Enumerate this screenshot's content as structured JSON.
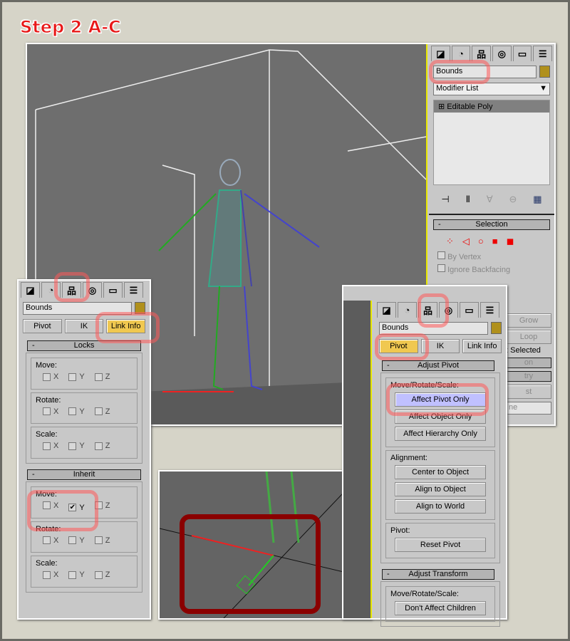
{
  "title": "Step 2 A-C",
  "colors": {
    "highlight": "#ff5a5a",
    "object_color": "#b0901c",
    "active_button": "#f0c850",
    "affect_pivot_button": "#c0c0ff",
    "viewport": "#6e6e6e"
  },
  "tabs": [
    "create-icon",
    "modify-icon",
    "hierarchy-icon",
    "motion-icon",
    "display-icon",
    "utilities-icon"
  ],
  "main_panel": {
    "object_name": "Bounds",
    "modifier_list": "Modifier List",
    "stack_item": "Editable Poly",
    "selection_header": "Selection",
    "by_vertex": "By Vertex",
    "ignore_backfacing": "Ignore Backfacing",
    "grow": "Grow",
    "loop": "Loop",
    "selected_partial": "t Selected",
    "partial_headers": [
      "on",
      "try"
    ],
    "partial_button": "st",
    "partial_select": "ne"
  },
  "left_panel": {
    "object_name": "Bounds",
    "buttons": [
      "Pivot",
      "IK",
      "Link Info"
    ],
    "locks_header": "Locks",
    "inherit_header": "Inherit",
    "groups": [
      "Move:",
      "Rotate:",
      "Scale:"
    ],
    "axes": [
      "X",
      "Y",
      "Z"
    ],
    "inherit_move_checked": [
      "Y"
    ]
  },
  "right_panel": {
    "object_name": "Bounds",
    "buttons": [
      "Pivot",
      "IK",
      "Link Info"
    ],
    "adjust_pivot_header": "Adjust Pivot",
    "mrs_label": "Move/Rotate/Scale:",
    "affect_buttons": [
      "Affect Pivot Only",
      "Affect Object Only",
      "Affect Hierarchy Only"
    ],
    "alignment_label": "Alignment:",
    "alignment_buttons": [
      "Center to Object",
      "Align to Object",
      "Align to World"
    ],
    "pivot_label": "Pivot:",
    "reset_pivot": "Reset Pivot",
    "adjust_transform_header": "Adjust Transform",
    "mrs_label2": "Move/Rotate/Scale:",
    "dont_affect": "Don't Affect Children"
  }
}
